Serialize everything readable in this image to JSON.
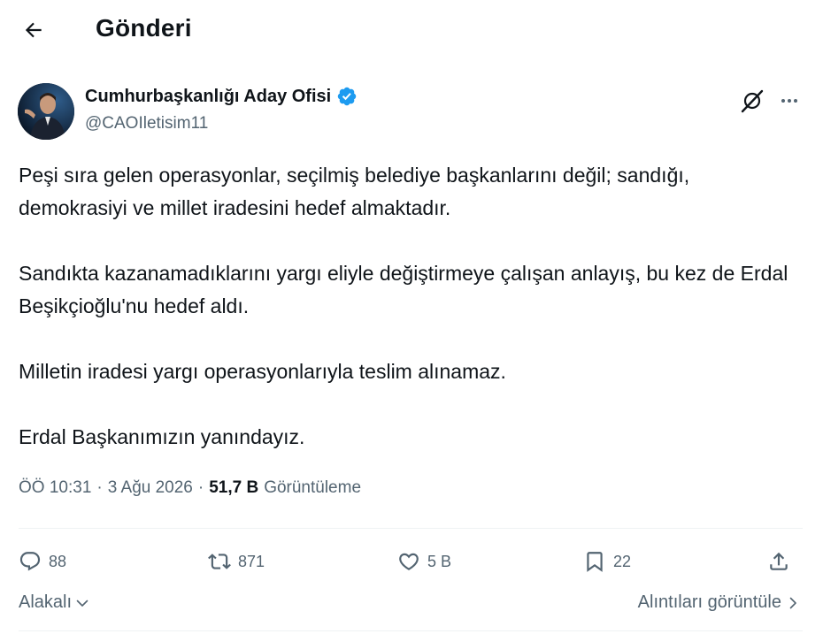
{
  "header": {
    "title": "Gönderi",
    "back_icon": "arrow-left-icon"
  },
  "author": {
    "name": "Cumhurbaşkanlığı Aday Ofisi",
    "handle": "@CAOIletisim11",
    "verified": true,
    "verified_color": "#1d9bf0"
  },
  "tweet": {
    "paragraphs": [
      "Peşi sıra gelen operasyonlar, seçilmiş belediye başkanlarını değil; sandığı, demokrasiyi ve millet iradesini hedef almaktadır.",
      "Sandıkta kazanamadıklarını yargı eliyle değiştirmeye çalışan anlayış, bu kez de Erdal Beşikçioğlu'nu hedef aldı.",
      "Milletin iradesi yargı operasyonlarıyla teslim alınamaz.",
      "Erdal Başkanımızın yanındayız."
    ]
  },
  "meta": {
    "time": "ÖÖ 10:31",
    "separator": "·",
    "date": "3 Ağu 2026",
    "views_count": "51,7 B",
    "views_label": "Görüntüleme"
  },
  "actions": {
    "reply_count": "88",
    "retweet_count": "871",
    "like_count": "5 B",
    "bookmark_count": "22"
  },
  "footer": {
    "sort_label": "Alakalı",
    "quotes_label": "Alıntıları görüntüle"
  },
  "colors": {
    "text": "#0f1419",
    "secondary": "#536471",
    "accent": "#1d9bf0",
    "divider": "#eff3f4"
  }
}
